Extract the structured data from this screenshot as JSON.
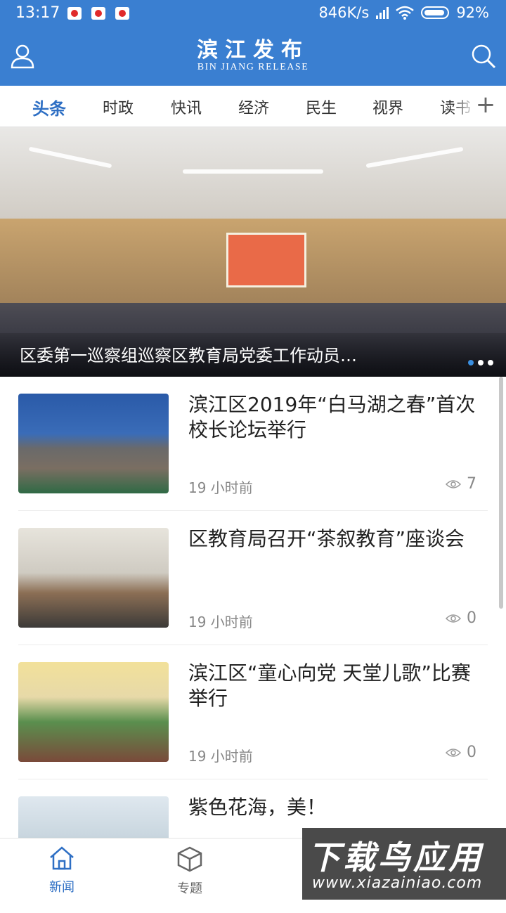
{
  "status": {
    "time": "13:17",
    "speed": "846K/s",
    "battery": "92%"
  },
  "header": {
    "title_cn": "滨江发布",
    "title_en": "BIN JIANG RELEASE"
  },
  "tabs": [
    {
      "label": "头条",
      "active": true
    },
    {
      "label": "时政"
    },
    {
      "label": "快讯"
    },
    {
      "label": "经济"
    },
    {
      "label": "民生"
    },
    {
      "label": "视界"
    },
    {
      "label": "读书"
    }
  ],
  "hero": {
    "caption": "区委第一巡察组巡察区教育局党委工作动员…"
  },
  "news": [
    {
      "title": "滨江区2019年“白马湖之春”首次校长论坛举行",
      "time": "19 小时前",
      "views": "7"
    },
    {
      "title": "区教育局召开“茶叙教育”座谈会",
      "time": "19 小时前",
      "views": "0"
    },
    {
      "title": "滨江区“童心向党 天堂儿歌”比赛举行",
      "time": "19 小时前",
      "views": "0"
    },
    {
      "title": "紫色花海，美！",
      "time": "",
      "views": ""
    }
  ],
  "bottom_nav": [
    {
      "label": "新闻",
      "active": true
    },
    {
      "label": "专题"
    }
  ],
  "watermark": {
    "big": "下载鸟应用",
    "small": "www.xiazainiao.com"
  },
  "colors": {
    "brand": "#3a7fd1",
    "active_tab": "#2e6fc4"
  }
}
